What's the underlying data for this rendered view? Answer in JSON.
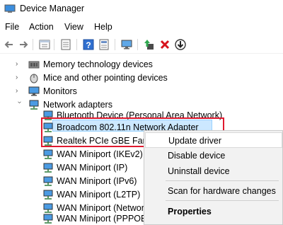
{
  "window": {
    "title": "Device Manager"
  },
  "menu": [
    "File",
    "Action",
    "View",
    "Help"
  ],
  "toolbar": {
    "buttons": [
      "back-arrow-icon",
      "forward-arrow-icon",
      "properties-icon",
      "list-icon",
      "help-icon",
      "monitor-icon",
      "update-driver-icon",
      "uninstall-x-icon",
      "download-icon"
    ]
  },
  "tree": {
    "nodes": [
      {
        "label": "Memory technology devices",
        "icon": "memory-icon",
        "expander": "collapsed"
      },
      {
        "label": "Mice and other pointing devices",
        "icon": "mouse-icon",
        "expander": "collapsed"
      },
      {
        "label": "Monitors",
        "icon": "monitor-icon",
        "expander": "collapsed"
      },
      {
        "label": "Network adapters",
        "icon": "network-icon",
        "expander": "expanded"
      }
    ],
    "network_children": [
      "Bluetooth Device (Personal Area Network)",
      "Broadcom 802.11n Network Adapter",
      "Realtek PCIe GBE Famil",
      "WAN Miniport (IKEv2)",
      "WAN Miniport (IP)",
      "WAN Miniport (IPv6)",
      "WAN Miniport (L2TP)",
      "WAN Miniport (Networ",
      "WAN Miniport (PPPOE)"
    ]
  },
  "context_menu": {
    "items": [
      "Update driver",
      "Disable device",
      "Uninstall device",
      "Scan for hardware changes",
      "Properties"
    ]
  },
  "colors": {
    "highlight_border": "#e0192f",
    "selection": "#cce8ff",
    "menu_bg": "#f2f2f2"
  }
}
